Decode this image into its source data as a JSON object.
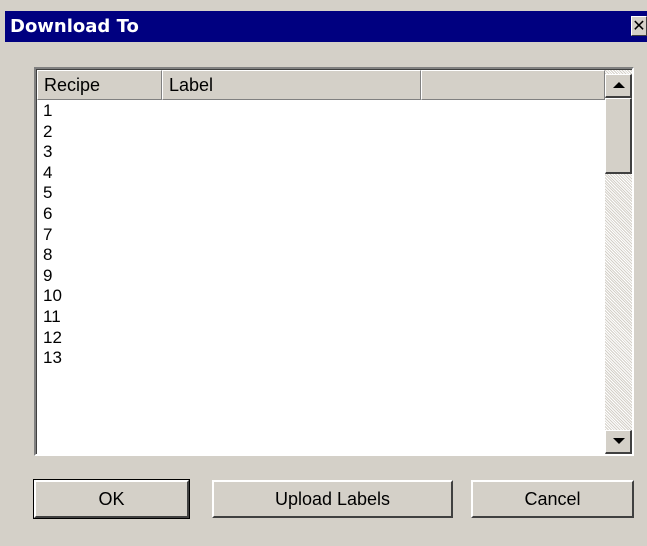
{
  "dialog": {
    "title": "Download To",
    "close_glyph": "✕"
  },
  "list": {
    "columns": [
      "Recipe",
      "Label",
      ""
    ],
    "rows": [
      {
        "recipe": "1",
        "label": ""
      },
      {
        "recipe": "2",
        "label": ""
      },
      {
        "recipe": "3",
        "label": ""
      },
      {
        "recipe": "4",
        "label": ""
      },
      {
        "recipe": "5",
        "label": ""
      },
      {
        "recipe": "6",
        "label": ""
      },
      {
        "recipe": "7",
        "label": ""
      },
      {
        "recipe": "8",
        "label": ""
      },
      {
        "recipe": "9",
        "label": ""
      },
      {
        "recipe": "10",
        "label": ""
      },
      {
        "recipe": "11",
        "label": ""
      },
      {
        "recipe": "12",
        "label": ""
      },
      {
        "recipe": "13",
        "label": ""
      }
    ]
  },
  "buttons": {
    "ok": "OK",
    "upload_labels": "Upload Labels",
    "cancel": "Cancel"
  },
  "icons": {
    "close": "close-icon",
    "scroll_up": "arrow-up-icon",
    "scroll_down": "arrow-down-icon"
  },
  "colors": {
    "titlebar": "#000080",
    "face": "#d4d0c8",
    "list_bg": "#ffffff"
  }
}
